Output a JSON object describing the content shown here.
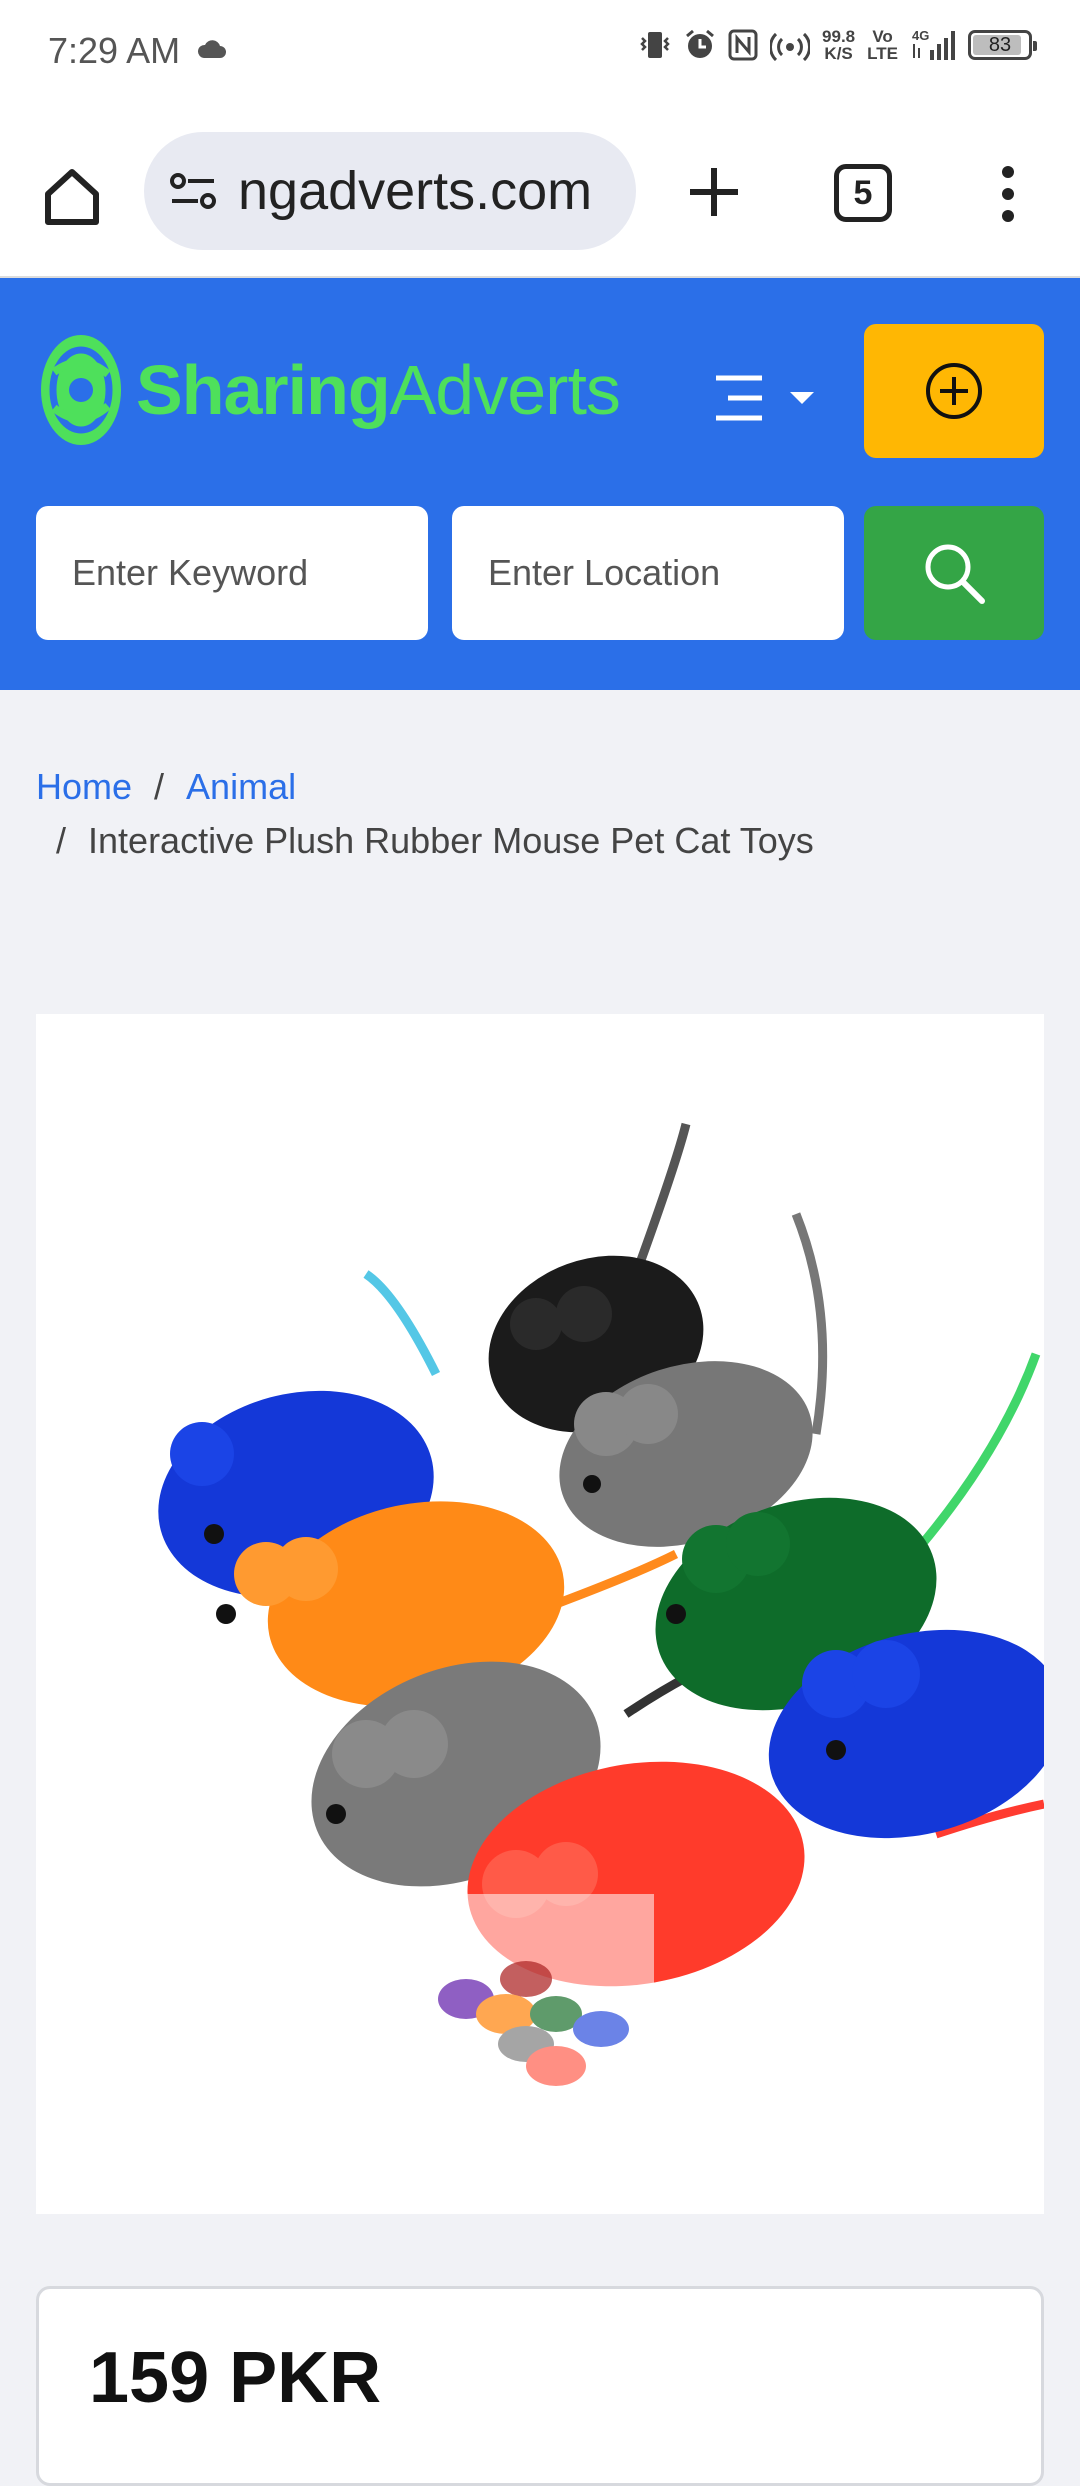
{
  "status_bar": {
    "time": "7:29 AM",
    "net_speed_value": "99.8",
    "net_speed_unit": "K/S",
    "volte_top": "Vo",
    "volte_bottom": "LTE",
    "network": "4G",
    "battery": "83"
  },
  "browser": {
    "url_text": "ngadverts.com",
    "tab_count": "5"
  },
  "site": {
    "logo_text_bold": "Sharing",
    "logo_text_light": "Adverts",
    "keyword_placeholder": "Enter Keyword",
    "location_placeholder": "Enter Location",
    "colors": {
      "header_bg": "#2b6fe8",
      "post_button": "#ffb703",
      "search_button": "#34a546",
      "logo_green": "#4ee05b"
    }
  },
  "breadcrumb": {
    "home": "Home",
    "category": "Animal",
    "separator": "/",
    "current": "Interactive Plush Rubber Mouse Pet Cat Toys"
  },
  "product": {
    "image_icon": "plush-mice-toys-image",
    "price": "159 PKR"
  }
}
